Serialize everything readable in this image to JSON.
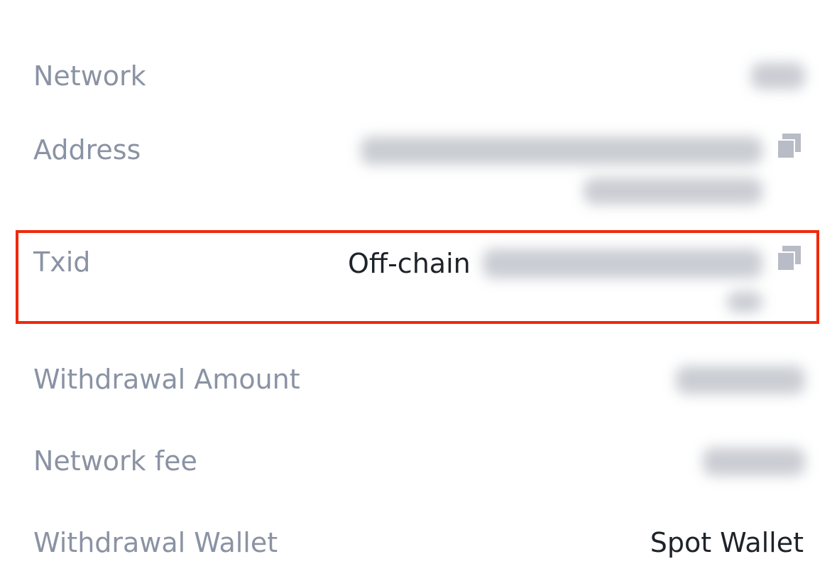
{
  "details": {
    "network": {
      "label": "Network"
    },
    "address": {
      "label": "Address",
      "copy_icon": "copy-icon"
    },
    "txid": {
      "label": "Txid",
      "value_prefix": "Off-chain",
      "copy_icon": "copy-icon"
    },
    "withdrawal_amount": {
      "label": "Withdrawal Amount"
    },
    "network_fee": {
      "label": "Network fee"
    },
    "withdrawal_wallet": {
      "label": "Withdrawal Wallet",
      "value": "Spot Wallet"
    }
  },
  "colors": {
    "label": "#8a93a4",
    "value": "#1e2329",
    "highlight": "#f0290a",
    "icon": "#b7bcc6"
  }
}
